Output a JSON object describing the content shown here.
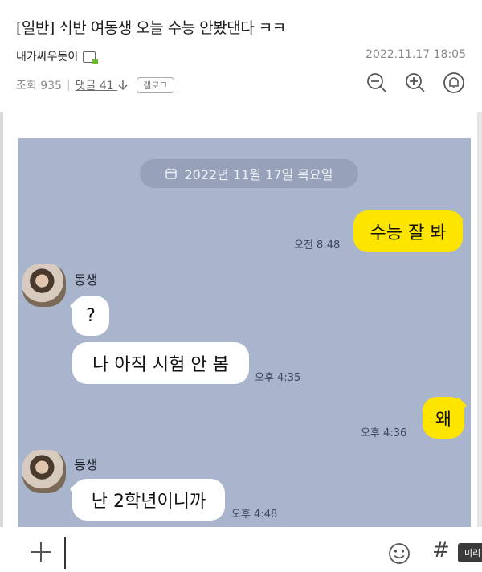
{
  "post": {
    "title": "[일반] ᄉᆡ반 여동생 오늘 수능 안봤댄다 ㅋㅋ",
    "author": "내가싸우듯이",
    "date": "2022.11.17 18:05",
    "views": "조회 935",
    "comments": "댓글 41",
    "gallery_tag": "갤로그"
  },
  "chat": {
    "date_divider": "2022년 11월 17일 목요일",
    "messages": [
      {
        "from": "me",
        "text": "수능 잘 봐",
        "time": "오전 8:48"
      },
      {
        "from": "other",
        "sender": "동생",
        "text": "?",
        "time": ""
      },
      {
        "from": "other",
        "sender": "동생",
        "text": "나 아직 시험 안 봄",
        "time": "오후 4:35"
      },
      {
        "from": "me",
        "text": "왜",
        "time": "오후 4:36"
      },
      {
        "from": "other",
        "sender": "동생",
        "text": "난 2학년이니까",
        "time": "오후 4:48"
      }
    ]
  },
  "input": {
    "hash": "#",
    "preview_tooltip": "미리"
  },
  "colors": {
    "chat_bg": "#a8b5cd",
    "my_bubble": "#fee500",
    "other_bubble": "#ffffff"
  }
}
